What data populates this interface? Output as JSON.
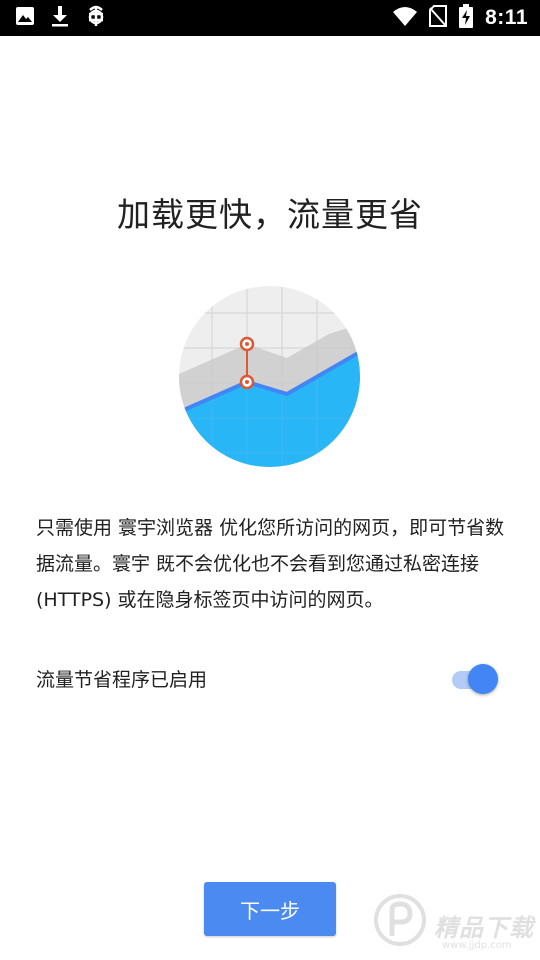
{
  "status_bar": {
    "time": "8:11",
    "left_icons": [
      "image-icon",
      "download-icon",
      "bug-icon"
    ],
    "right_icons": [
      "wifi-icon",
      "no-sim-icon",
      "battery-charging-icon"
    ]
  },
  "onboarding": {
    "title": "加载更快，流量更省",
    "description": "只需使用 寰宇浏览器 优化您所访问的网页，即可节省数据流量。寰宇 既不会优化也不会看到您通过私密连接 (HTTPS) 或在隐身标签页中访问的网页。",
    "toggle_label": "流量节省程序已启用",
    "toggle_on": true,
    "next_button": "下一步"
  },
  "watermark": {
    "text": "精品下载",
    "sub": "www.jjdp.com"
  },
  "colors": {
    "accent": "#4285f4",
    "button": "#4b8af0",
    "chart_fill": "#29b6f6",
    "chart_line": "#4285f4",
    "marker": "#dd5833"
  }
}
